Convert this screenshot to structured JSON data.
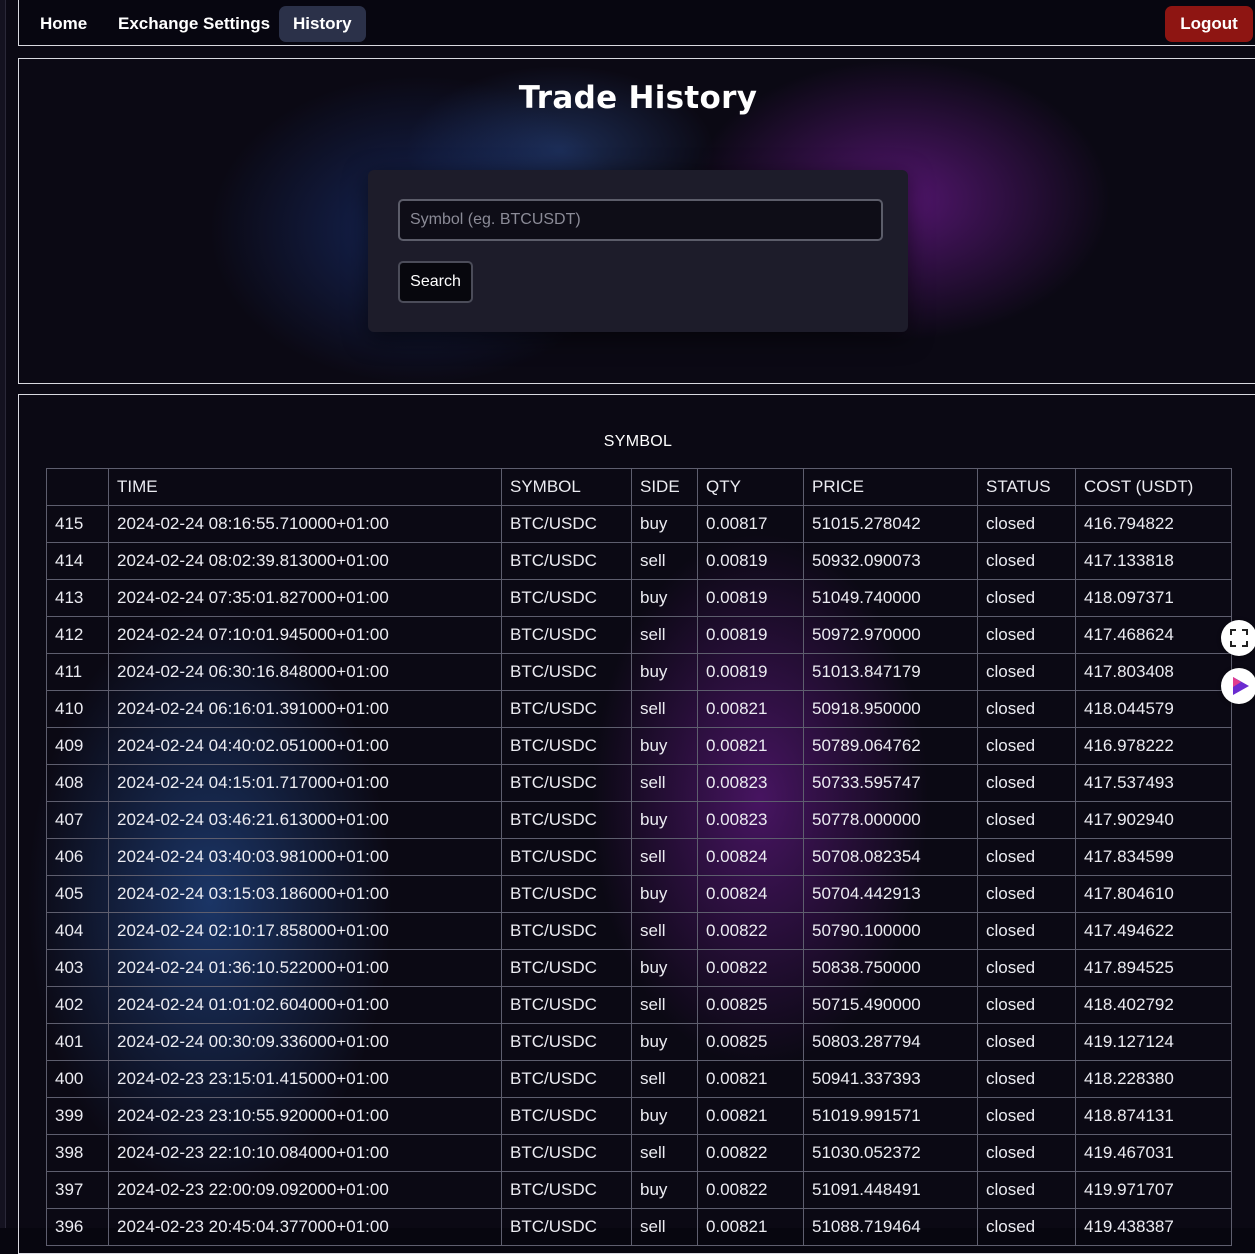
{
  "nav": {
    "home": "Home",
    "exchange_settings": "Exchange Settings",
    "history": "History",
    "logout": "Logout"
  },
  "page": {
    "title": "Trade History"
  },
  "search": {
    "placeholder": "Symbol (eg. BTCUSDT)",
    "button": "Search"
  },
  "table": {
    "caption": "SYMBOL",
    "columns": [
      "",
      "TIME",
      "SYMBOL",
      "SIDE",
      "QTY",
      "PRICE",
      "STATUS",
      "COST (USDT)"
    ],
    "rows": [
      [
        "415",
        "2024-02-24 08:16:55.710000+01:00",
        "BTC/USDC",
        "buy",
        "0.00817",
        "51015.278042",
        "closed",
        "416.794822"
      ],
      [
        "414",
        "2024-02-24 08:02:39.813000+01:00",
        "BTC/USDC",
        "sell",
        "0.00819",
        "50932.090073",
        "closed",
        "417.133818"
      ],
      [
        "413",
        "2024-02-24 07:35:01.827000+01:00",
        "BTC/USDC",
        "buy",
        "0.00819",
        "51049.740000",
        "closed",
        "418.097371"
      ],
      [
        "412",
        "2024-02-24 07:10:01.945000+01:00",
        "BTC/USDC",
        "sell",
        "0.00819",
        "50972.970000",
        "closed",
        "417.468624"
      ],
      [
        "411",
        "2024-02-24 06:30:16.848000+01:00",
        "BTC/USDC",
        "buy",
        "0.00819",
        "51013.847179",
        "closed",
        "417.803408"
      ],
      [
        "410",
        "2024-02-24 06:16:01.391000+01:00",
        "BTC/USDC",
        "sell",
        "0.00821",
        "50918.950000",
        "closed",
        "418.044579"
      ],
      [
        "409",
        "2024-02-24 04:40:02.051000+01:00",
        "BTC/USDC",
        "buy",
        "0.00821",
        "50789.064762",
        "closed",
        "416.978222"
      ],
      [
        "408",
        "2024-02-24 04:15:01.717000+01:00",
        "BTC/USDC",
        "sell",
        "0.00823",
        "50733.595747",
        "closed",
        "417.537493"
      ],
      [
        "407",
        "2024-02-24 03:46:21.613000+01:00",
        "BTC/USDC",
        "buy",
        "0.00823",
        "50778.000000",
        "closed",
        "417.902940"
      ],
      [
        "406",
        "2024-02-24 03:40:03.981000+01:00",
        "BTC/USDC",
        "sell",
        "0.00824",
        "50708.082354",
        "closed",
        "417.834599"
      ],
      [
        "405",
        "2024-02-24 03:15:03.186000+01:00",
        "BTC/USDC",
        "buy",
        "0.00824",
        "50704.442913",
        "closed",
        "417.804610"
      ],
      [
        "404",
        "2024-02-24 02:10:17.858000+01:00",
        "BTC/USDC",
        "sell",
        "0.00822",
        "50790.100000",
        "closed",
        "417.494622"
      ],
      [
        "403",
        "2024-02-24 01:36:10.522000+01:00",
        "BTC/USDC",
        "buy",
        "0.00822",
        "50838.750000",
        "closed",
        "417.894525"
      ],
      [
        "402",
        "2024-02-24 01:01:02.604000+01:00",
        "BTC/USDC",
        "sell",
        "0.00825",
        "50715.490000",
        "closed",
        "418.402792"
      ],
      [
        "401",
        "2024-02-24 00:30:09.336000+01:00",
        "BTC/USDC",
        "buy",
        "0.00825",
        "50803.287794",
        "closed",
        "419.127124"
      ],
      [
        "400",
        "2024-02-23 23:15:01.415000+01:00",
        "BTC/USDC",
        "sell",
        "0.00821",
        "50941.337393",
        "closed",
        "418.228380"
      ],
      [
        "399",
        "2024-02-23 23:10:55.920000+01:00",
        "BTC/USDC",
        "buy",
        "0.00821",
        "51019.991571",
        "closed",
        "418.874131"
      ],
      [
        "398",
        "2024-02-23 22:10:10.084000+01:00",
        "BTC/USDC",
        "sell",
        "0.00822",
        "51030.052372",
        "closed",
        "419.467031"
      ],
      [
        "397",
        "2024-02-23 22:00:09.092000+01:00",
        "BTC/USDC",
        "buy",
        "0.00822",
        "51091.448491",
        "closed",
        "419.971707"
      ],
      [
        "396",
        "2024-02-23 20:45:04.377000+01:00",
        "BTC/USDC",
        "sell",
        "0.00821",
        "51088.719464",
        "closed",
        "419.438387"
      ]
    ]
  },
  "widgets": {
    "fullscreen_icon": "fullscreen-icon",
    "extension_icon": "extension-icon"
  },
  "colors": {
    "logout_bg": "#8e1512",
    "active_nav_bg": "#2b3149",
    "panel_border": "#d9d9e0"
  }
}
